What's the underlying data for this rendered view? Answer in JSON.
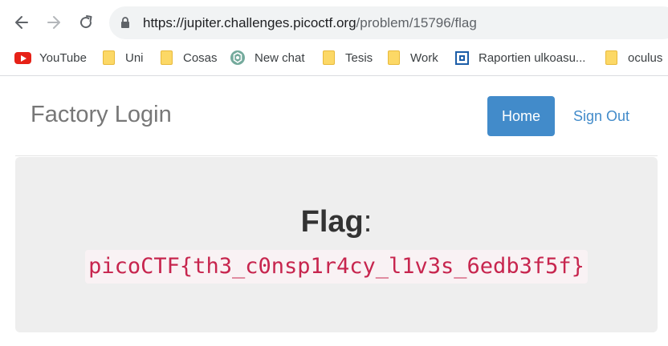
{
  "browser": {
    "url_host": "https://jupiter.challenges.picoctf.org",
    "url_path": "/problem/15796/flag",
    "bookmarks": [
      {
        "label": "YouTube",
        "icon": "youtube-icon"
      },
      {
        "label": "Uni",
        "icon": "folder-icon"
      },
      {
        "label": "Cosas",
        "icon": "folder-icon"
      },
      {
        "label": "New chat",
        "icon": "chatgpt-icon"
      },
      {
        "label": "Tesis",
        "icon": "folder-icon"
      },
      {
        "label": "Work",
        "icon": "folder-icon"
      },
      {
        "label": "Raportien ulkoasu...",
        "icon": "raportti-icon"
      },
      {
        "label": "oculus",
        "icon": "folder-icon"
      }
    ]
  },
  "navbar": {
    "brand": "Factory Login",
    "home_label": "Home",
    "signout_label": "Sign Out"
  },
  "main": {
    "flag_label": "Flag",
    "flag_colon": ":",
    "flag_value": "picoCTF{th3_c0nsp1r4cy_l1v3s_6edb3f5f}"
  },
  "colors": {
    "primary": "#428bca",
    "flag_code": "#c7254e",
    "flag_code_bg": "#f9f2f4",
    "jumbotron_bg": "#eeeeee"
  }
}
